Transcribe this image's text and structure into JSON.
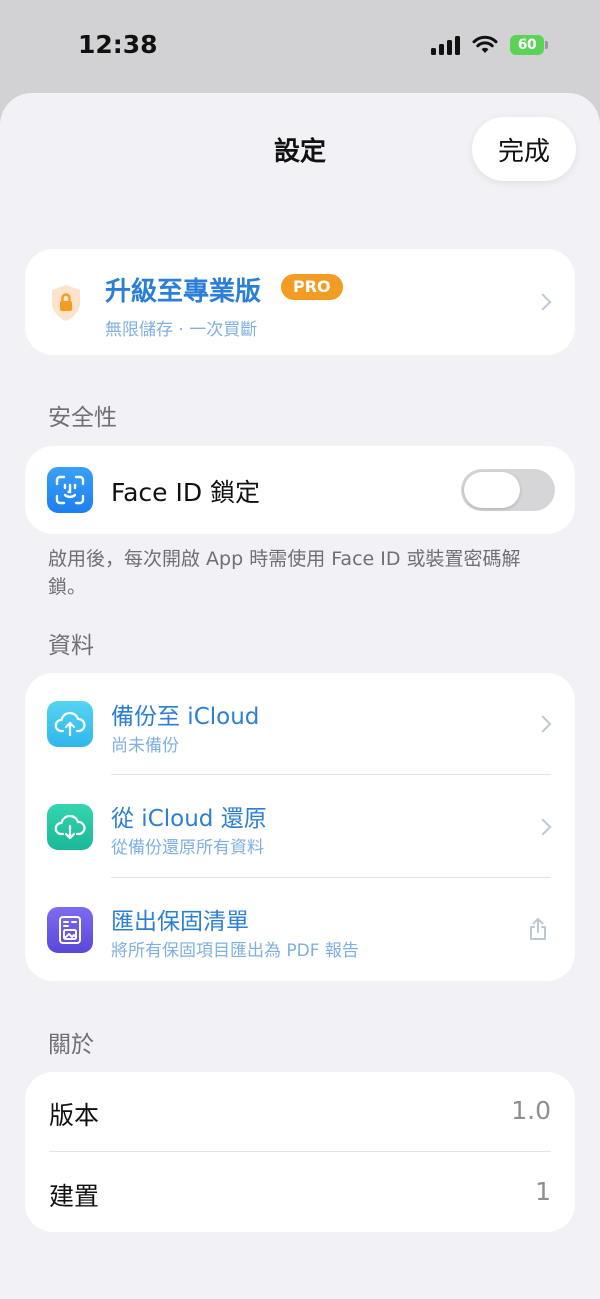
{
  "status_bar": {
    "time": "12:38",
    "battery": "60"
  },
  "nav": {
    "title": "設定",
    "done_label": "完成"
  },
  "pro": {
    "title": "升級至專業版",
    "badge": "PRO",
    "subtitle": "無限儲存 · 一次買斷"
  },
  "security": {
    "header": "安全性",
    "face_id_label": "Face ID 鎖定",
    "face_id_enabled": false,
    "footnote": "啟用後，每次開啟 App 時需使用 Face ID 或裝置密碼解鎖。"
  },
  "data_section": {
    "header": "資料",
    "items": [
      {
        "title": "備份至 iCloud",
        "subtitle": "尚未備份"
      },
      {
        "title": "從 iCloud 還原",
        "subtitle": "從備份還原所有資料"
      },
      {
        "title": "匯出保固清單",
        "subtitle": "將所有保固項目匯出為 PDF 報告"
      }
    ]
  },
  "about": {
    "header": "關於",
    "rows": [
      {
        "label": "版本",
        "value": "1.0"
      },
      {
        "label": "建置",
        "value": "1"
      }
    ]
  },
  "colors": {
    "accent": "#2c7fd6",
    "pro_badge": "#f29c24",
    "background": "#f2f2f6"
  }
}
